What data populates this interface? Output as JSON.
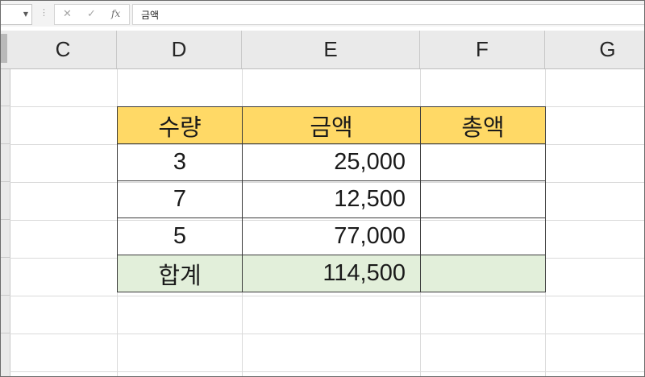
{
  "formula_bar": {
    "fx_label": "fx",
    "content": "금액",
    "name_box_value": ""
  },
  "columns": [
    "C",
    "D",
    "E",
    "F",
    "G"
  ],
  "table": {
    "headers": [
      "수량",
      "금액",
      "총액"
    ],
    "rows": [
      {
        "qty": "3",
        "amount": "25,000",
        "total": ""
      },
      {
        "qty": "7",
        "amount": "12,500",
        "total": ""
      },
      {
        "qty": "5",
        "amount": "77,000",
        "total": ""
      }
    ],
    "summary": {
      "label": "합계",
      "amount": "114,500",
      "total": ""
    }
  },
  "colors": {
    "header_fill": "#ffd966",
    "summary_fill": "#e2efda"
  }
}
